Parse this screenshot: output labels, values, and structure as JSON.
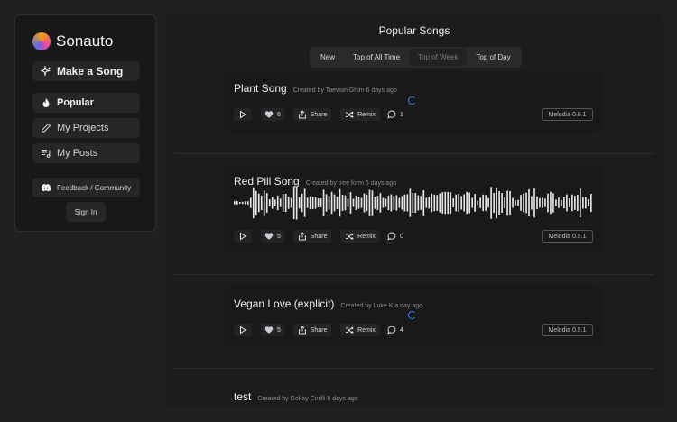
{
  "sidebar": {
    "brand": "Sonauto",
    "make_song": "Make a Song",
    "popular": "Popular",
    "my_projects": "My Projects",
    "my_posts": "My Posts",
    "feedback": "Feedback / Community",
    "sign_in": "Sign In"
  },
  "main": {
    "title": "Popular Songs",
    "tabs": [
      {
        "label": "New"
      },
      {
        "label": "Top of All Time"
      },
      {
        "label": "Top of Week"
      },
      {
        "label": "Top of Day"
      }
    ]
  },
  "labels": {
    "share": "Share",
    "remix": "Remix"
  },
  "songs": [
    {
      "title": "Plant Song",
      "meta": "Created by Taewan Ghim 6 days ago",
      "likes": "6",
      "comments": "1",
      "model": "Melodia 0.9.1"
    },
    {
      "title": "Red Pill Song",
      "meta": "Created by tree form 6 days ago",
      "likes": "5",
      "comments": "0",
      "model": "Melodia 0.9.1"
    },
    {
      "title": "Vegan Love (explicit)",
      "meta": "Created by Luke K a day ago",
      "likes": "5",
      "comments": "4",
      "model": "Melodia 0.9.1"
    },
    {
      "title": "test",
      "meta": "Created by Gokay Cinilli 6 days ago"
    }
  ],
  "colors": {
    "accent": "#3b82f6",
    "background": "#202020",
    "card": "#191919"
  },
  "icons": [
    "sparkle-icon",
    "flame-icon",
    "pencil-icon",
    "playlist-icon",
    "discord-icon",
    "play-icon",
    "heart-icon",
    "share-icon",
    "shuffle-icon",
    "comment-icon"
  ]
}
